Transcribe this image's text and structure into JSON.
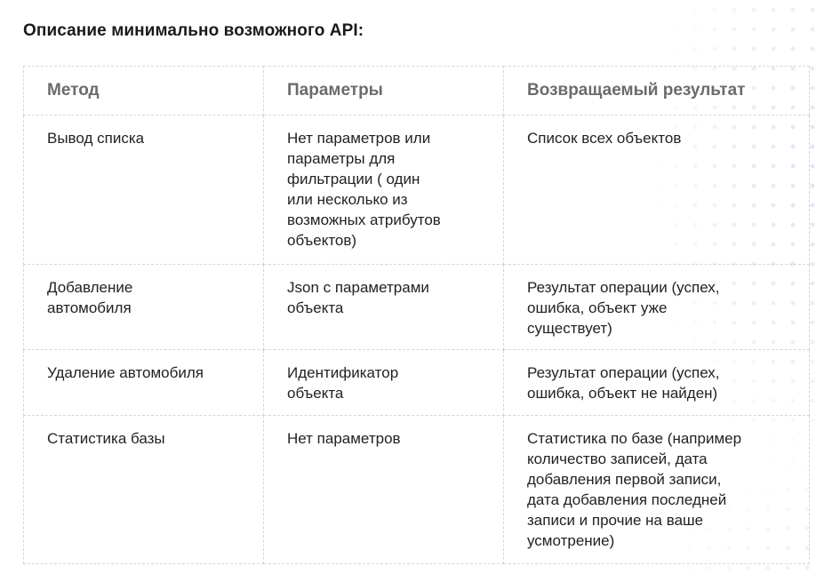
{
  "title": "Описание минимально возможного API:",
  "table": {
    "headers": [
      "Метод",
      "Параметры",
      "Возвращаемый результат"
    ],
    "rows": [
      {
        "method": "Вывод списка",
        "params": "Нет параметров или\nпараметры для\nфильтрации ( один\nили несколько из\nвозможных атрибутов\nобъектов)",
        "result": "Список всех объектов"
      },
      {
        "method": "Добавление\nавтомобиля",
        "params": "Json с параметрами\nобъекта",
        "result": "Результат операции (успех,\nошибка, объект уже\nсуществует)"
      },
      {
        "method": "Удаление автомобиля",
        "params": "Идентификатор\nобъекта",
        "result": "Результат операции (успех,\nошибка, объект не найден)"
      },
      {
        "method": "Статистика базы",
        "params": "Нет параметров",
        "result": "Статистика по базе (например\nколичество записей, дата\nдобавления первой записи,\nдата добавления последней\nзаписи и прочие на ваше\nусмотрение)"
      }
    ]
  }
}
